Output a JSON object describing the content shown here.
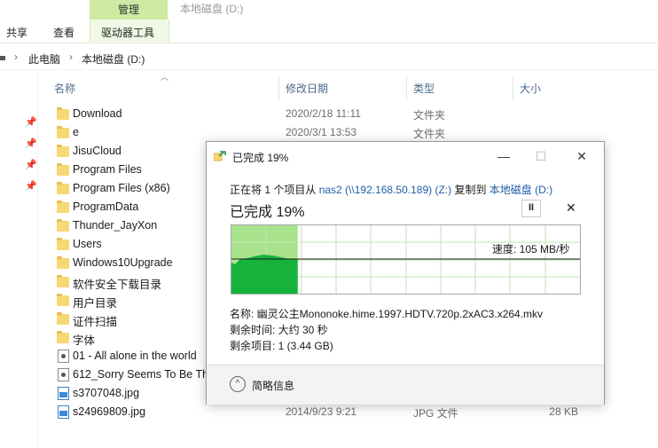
{
  "window": {
    "title": "本地磁盘 (D:)"
  },
  "ribbon": {
    "context_tab": "管理",
    "tabs": [
      "共享",
      "查看",
      "驱动器工具"
    ]
  },
  "address": {
    "crumbs": [
      "此电脑",
      "本地磁盘 (D:)"
    ],
    "separator": "›"
  },
  "columns": {
    "name": "名称",
    "date": "修改日期",
    "type": "类型",
    "size": "大小"
  },
  "files": [
    {
      "name": "Download",
      "date": "2020/2/18 11:11",
      "type": "文件夹",
      "size": "",
      "icon": "folder-icon"
    },
    {
      "name": "e",
      "date": "2020/3/1 13:53",
      "type": "文件夹",
      "size": "",
      "icon": "folder-icon"
    },
    {
      "name": "JisuCloud",
      "date": "",
      "type": "",
      "size": "",
      "icon": "folder-icon"
    },
    {
      "name": "Program Files",
      "date": "",
      "type": "",
      "size": "",
      "icon": "folder-icon"
    },
    {
      "name": "Program Files (x86)",
      "date": "",
      "type": "",
      "size": "",
      "icon": "folder-icon"
    },
    {
      "name": "ProgramData",
      "date": "",
      "type": "",
      "size": "",
      "icon": "folder-icon"
    },
    {
      "name": "Thunder_JayXon",
      "date": "",
      "type": "",
      "size": "",
      "icon": "folder-icon"
    },
    {
      "name": "Users",
      "date": "",
      "type": "",
      "size": "",
      "icon": "folder-icon"
    },
    {
      "name": "Windows10Upgrade",
      "date": "",
      "type": "",
      "size": "",
      "icon": "folder-icon"
    },
    {
      "name": "软件安全下载目录",
      "date": "",
      "type": "",
      "size": "",
      "icon": "folder-icon"
    },
    {
      "name": "用户目录",
      "date": "",
      "type": "",
      "size": "",
      "icon": "folder-icon"
    },
    {
      "name": "证件扫描",
      "date": "",
      "type": "",
      "size": "",
      "icon": "folder-icon"
    },
    {
      "name": "字体",
      "date": "",
      "type": "",
      "size": "",
      "icon": "folder-icon"
    },
    {
      "name": "01 - All alone in the world",
      "date": "",
      "type": "",
      "size": "",
      "icon": "music-file-icon"
    },
    {
      "name": "612_Sorry Seems To Be Th",
      "date": "",
      "type": "",
      "size": "",
      "icon": "music-file-icon"
    },
    {
      "name": "s3707048.jpg",
      "date": "",
      "type": "",
      "size": "",
      "icon": "image-file-icon"
    },
    {
      "name": "s24969809.jpg",
      "date": "2014/9/23 9:21",
      "type": "JPG 文件",
      "size": "28 KB",
      "icon": "image-file-icon"
    }
  ],
  "dialog": {
    "title": "已完成 19%",
    "progress_percent": 19,
    "controls": {
      "minimize": "—",
      "maximize": "☐",
      "close": "✕"
    },
    "copy_prefix": "正在将 1 个项目从 ",
    "source_name": "nas2",
    "source_path": " (\\\\192.168.50.189) (Z:)",
    "copy_mid": " 复制到 ",
    "dest_name": "本地磁盘 (D:)",
    "status": "已完成 19%",
    "pause_glyph": "II",
    "cancel_glyph": "✕",
    "speed_label": "速度: 105 MB/秒",
    "name_line": "名称: 幽灵公主Mononoke.hime.1997.HDTV.720p.2xAC3.x264.mkv",
    "time_line": "剩余时间: 大约 30 秒",
    "items_line": "剩余项目: 1 (3.44 GB)",
    "more_info": "简略信息",
    "more_glyph": "^",
    "colors": {
      "progress_fill": "#a8e28c",
      "speed_area": "#15b33c",
      "grid": "#bfe6b0"
    }
  }
}
